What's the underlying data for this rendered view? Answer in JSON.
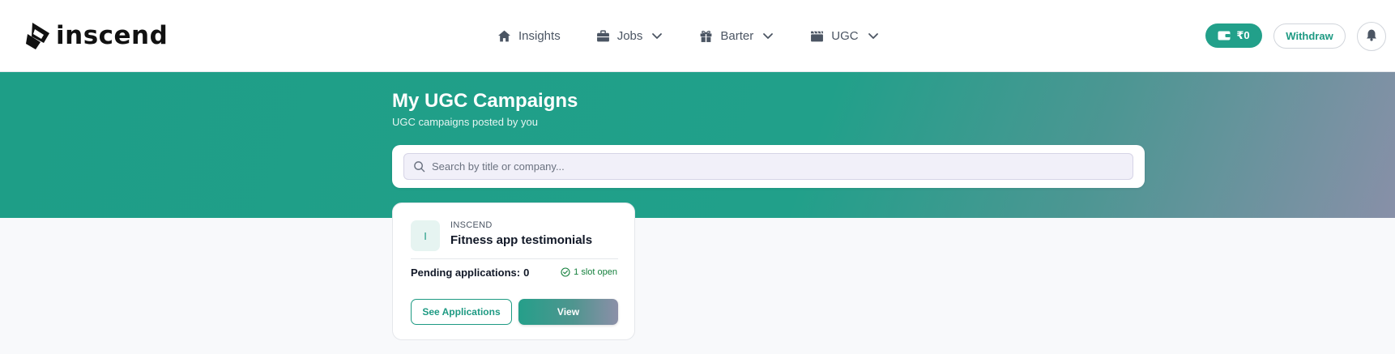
{
  "brand": {
    "name": "inscend",
    "accent": "#22a08a"
  },
  "nav": {
    "items": [
      {
        "label": "Insights",
        "icon": "home-icon",
        "dropdown": false
      },
      {
        "label": "Jobs",
        "icon": "briefcase-icon",
        "dropdown": true
      },
      {
        "label": "Barter",
        "icon": "gift-icon",
        "dropdown": true
      },
      {
        "label": "UGC",
        "icon": "clapperboard-icon",
        "dropdown": true
      }
    ]
  },
  "header_actions": {
    "wallet_amount": "₹0",
    "wallet_icon": "wallet-icon",
    "withdraw_label": "Withdraw",
    "bell_icon": "bell-icon"
  },
  "page": {
    "title": "My UGC Campaigns",
    "subtitle": "UGC campaigns posted by you"
  },
  "search": {
    "placeholder": "Search by title or company...",
    "value": ""
  },
  "campaigns": [
    {
      "avatar_letter": "I",
      "company": "INSCEND",
      "title": "Fitness app testimonials",
      "pending_label": "Pending applications:",
      "pending_count": "0",
      "slots_text": "1 slot open",
      "see_applications_label": "See Applications",
      "view_label": "View"
    }
  ]
}
